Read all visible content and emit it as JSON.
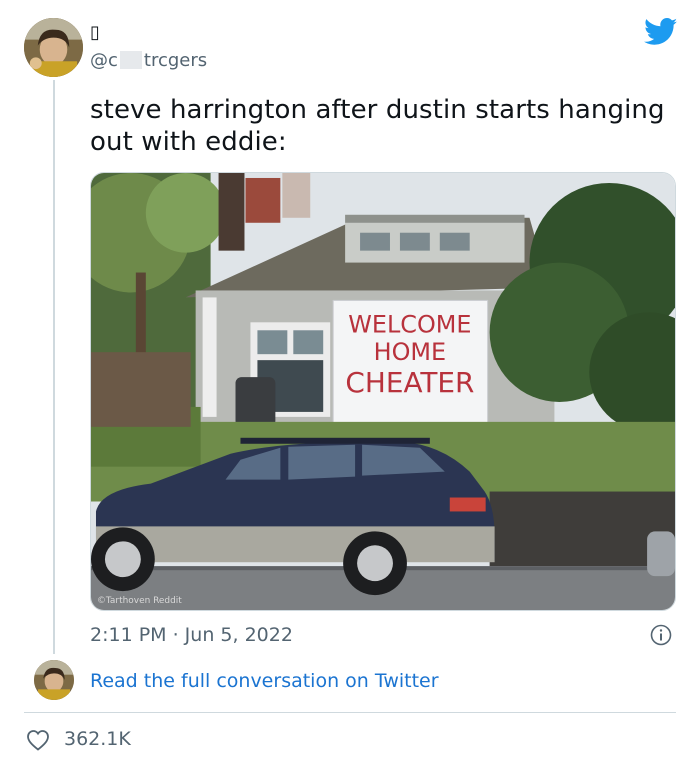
{
  "tweet": {
    "display_name": "▯",
    "handle_prefix": "@c",
    "handle_suffix": "trcgers",
    "text": "steve harrington after dustin starts hanging out with eddie:",
    "timestamp": "2:11 PM · Jun 5, 2022",
    "likes": "362.1K"
  },
  "media": {
    "sign_lines": [
      "WELCOME",
      "HOME",
      "CHEATER"
    ],
    "watermark": "©Tarthoven Reddit"
  },
  "footer": {
    "read_link": "Read the full conversation on Twitter"
  },
  "icons": {
    "brand": "twitter-bird-icon",
    "info": "info-icon",
    "like": "heart-icon"
  },
  "colors": {
    "link": "#1b74d1",
    "brand": "#1d9bf0",
    "muted": "#536471",
    "sign_text": "#b8323c"
  }
}
